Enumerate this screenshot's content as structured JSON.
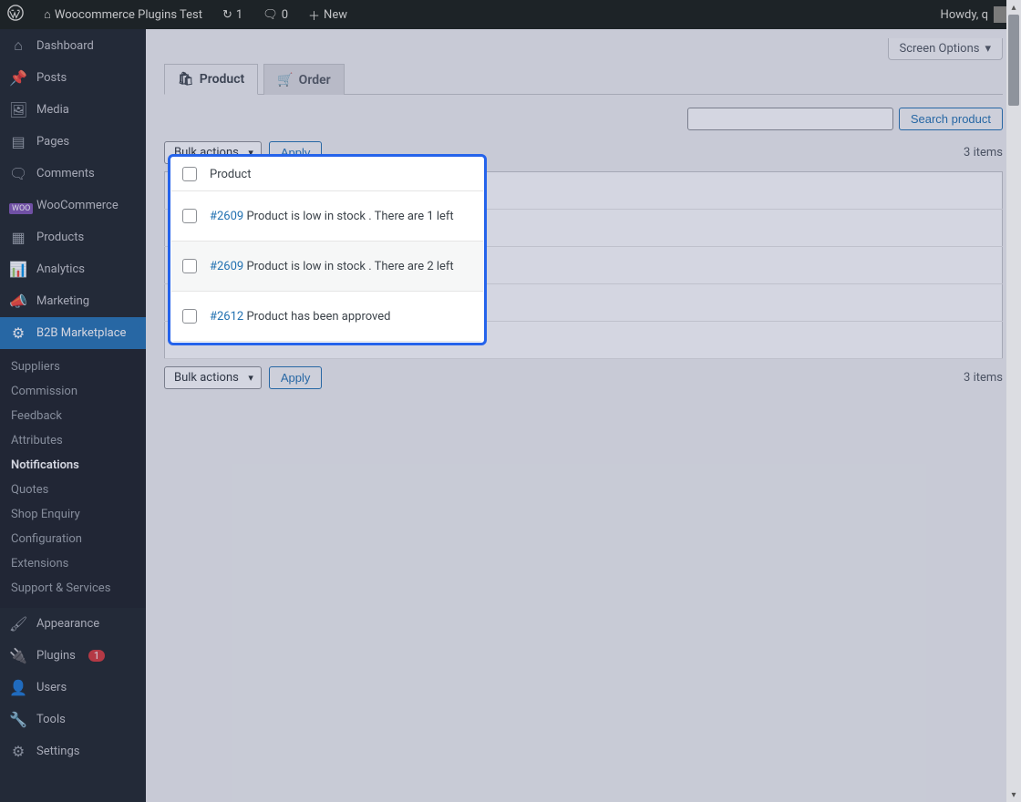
{
  "colors": {
    "accent": "#2271b1",
    "highlight": "#2563eb",
    "woo": "#7f54b3",
    "danger": "#d63638",
    "toolbar_bg": "#1d2327"
  },
  "toolbar": {
    "site_title": "Woocommerce Plugins Test",
    "refresh_count": "1",
    "comments_count": "0",
    "new_label": "New",
    "howdy_prefix": "Howdy,",
    "user_short": "q"
  },
  "sidebar": {
    "items": [
      {
        "icon": "⌂",
        "label": "Dashboard"
      },
      {
        "icon": "📌",
        "label": "Posts"
      },
      {
        "icon": "🖼",
        "label": "Media"
      },
      {
        "icon": "▤",
        "label": "Pages"
      },
      {
        "icon": "🗨",
        "label": "Comments"
      },
      {
        "icon": "woo",
        "label": "WooCommerce"
      },
      {
        "icon": "▦",
        "label": "Products"
      },
      {
        "icon": "📊",
        "label": "Analytics"
      },
      {
        "icon": "📣",
        "label": "Marketing"
      },
      {
        "icon": "⚙",
        "label": "B2B Marketplace",
        "current": true
      }
    ],
    "submenu": [
      {
        "label": "Suppliers"
      },
      {
        "label": "Commission"
      },
      {
        "label": "Feedback"
      },
      {
        "label": "Attributes"
      },
      {
        "label": "Notifications",
        "current": true
      },
      {
        "label": "Quotes"
      },
      {
        "label": "Shop Enquiry"
      },
      {
        "label": "Configuration"
      },
      {
        "label": "Extensions"
      },
      {
        "label": "Support & Services"
      }
    ],
    "bottom": [
      {
        "icon": "🖌",
        "label": "Appearance"
      },
      {
        "icon": "🔌",
        "label": "Plugins",
        "badge": "1"
      },
      {
        "icon": "👤",
        "label": "Users"
      },
      {
        "icon": "🔧",
        "label": "Tools"
      },
      {
        "icon": "⚙",
        "label": "Settings"
      }
    ]
  },
  "screen_options_label": "Screen Options",
  "tabs": [
    {
      "label": "Product",
      "active": true,
      "icon": "🛍"
    },
    {
      "label": "Order",
      "icon": "🛒"
    }
  ],
  "search": {
    "placeholder": "",
    "button": "Search product"
  },
  "bulk_actions_label": "Bulk actions",
  "apply_label": "Apply",
  "item_count": "3 items",
  "table": {
    "header": "Product",
    "rows": [
      {
        "link": "#2609",
        "text": "Product is low in stock . There are 1 left"
      },
      {
        "link": "#2609",
        "text": "Product is low in stock . There are 2 left"
      },
      {
        "link": "#2612",
        "text": "Product has been approved"
      }
    ]
  }
}
